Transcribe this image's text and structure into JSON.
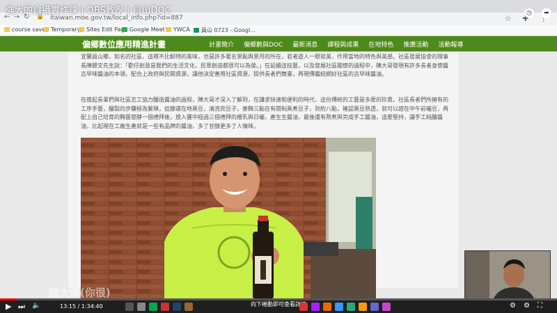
{
  "video": {
    "title": "強大的自攝實作課 | OBS教學 | 自山DOC",
    "watermark": "超大課(你很)"
  },
  "browser": {
    "url": "itaiwan.moe.gov.tw/local_info.php?id=887",
    "bookmarks": [
      {
        "label": "course save"
      },
      {
        "label": "Temporary"
      },
      {
        "label": "Sites Edit Page"
      },
      {
        "label": "Google Meet"
      },
      {
        "label": "YWCA"
      },
      {
        "label": "員山 0723 - Googl..."
      }
    ]
  },
  "site": {
    "logo": "偏鄉數位應用精進計畫",
    "nav": [
      "計畫簡介",
      "偏鄉數與DOC",
      "最新消息",
      "課程與成果",
      "在地特色",
      "推廣活動",
      "活動報導"
    ]
  },
  "content": {
    "para1": "宜蘭員山鄉，知名的社區，這裡不比較特的美味，也是許多著名景點與景月的所在，若者遊人一眼就美，作用當地的特色與美感。社區發展協會的理事長陳聰文先生說：「歡仔創意是我們的生活文化，民眾創造都很可以為榮。」在延續這技藝，以及發展社區關懷的過程中，陳大哥發現有許多長者身懷醬古早味醬油的本領，配合上政府與民間資源，讓他決定善用社區資源，提供長者們舞臺，再現傳醬結網好社區的古早味醬油。",
    "para2": "在擔起長輩們與社區志工協力釀造醬油的過程，陳大哥才深入了解到，在講求快速和便利的時代，這份傳統的工藝是多麼的珍貴。社區長者們所擁有的工序手藝，釀製的步驟極為繁瑣，從篩選在地黑豆，清洗完豆子，麥麴三點在有閱制蒸煮豆子，到約八點，確認黑豆熟透，就可以趕在中午前曬豆，再配上自己培育的麴菌發酵一個禮拜後，放入甕中經過三個禮拜的攪乳與日曬，產生生醬油，最後還有熬煮與完成手工醬油，這麼堅持，讓手工純釀醬油，比起現在工廠生產就是一些有品牌的醬油，多了甘醇更多了人情味。"
  },
  "player": {
    "time": "13:15 / 1:34:40",
    "hint": "向下捲動即可查看詳情"
  },
  "colors": {
    "nav_green": "#4e8a1b",
    "brick": "#8a4a30",
    "shirt": "#c8ef46",
    "progress_red": "#ff0000"
  }
}
